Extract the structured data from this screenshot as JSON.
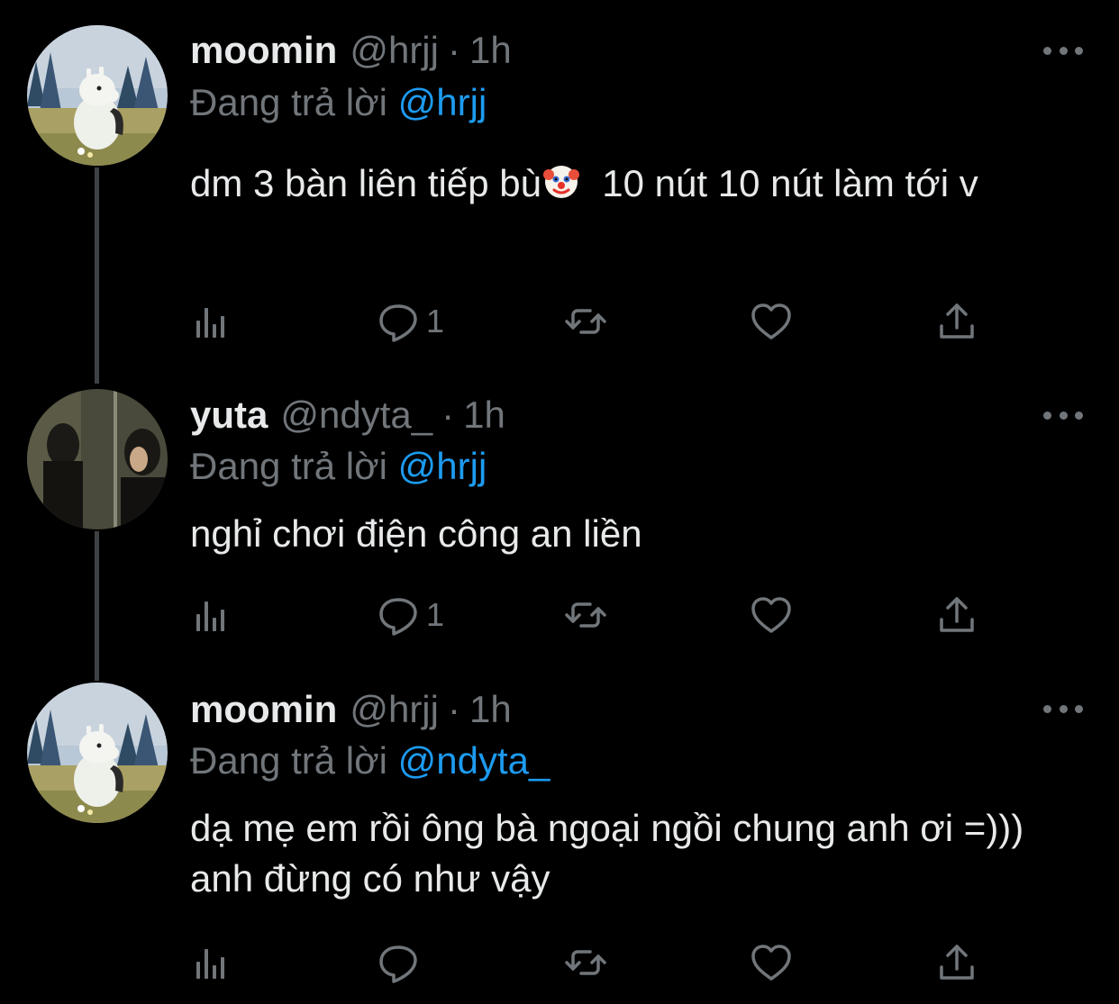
{
  "tweets": [
    {
      "name": "moomin",
      "handle": "@hrjj",
      "separator": "·",
      "time": "1h",
      "replying_prefix": "Đang trả lời",
      "replying_to": "@hrjj",
      "text_before_emoji": "dm 3 bàn liên tiếp bù",
      "emoji": "clown-face",
      "text_after_emoji": "  10 nút 10 nút làm tới v",
      "reply_count": "1",
      "avatar": "moomin-avatar"
    },
    {
      "name": "yuta",
      "handle": "@ndyta_",
      "separator": "·",
      "time": "1h",
      "replying_prefix": "Đang trả lời",
      "replying_to": "@hrjj",
      "text": "nghỉ chơi điện công an liền",
      "reply_count": "1",
      "avatar": "mirror-photo-avatar"
    },
    {
      "name": "moomin",
      "handle": "@hrjj",
      "separator": "·",
      "time": "1h",
      "replying_prefix": "Đang trả lời",
      "replying_to": "@ndyta_",
      "text": "dạ mẹ em rồi ông bà ngoại ngồi chung anh ơi =))) anh đừng có như vậy",
      "reply_count": "",
      "avatar": "moomin-avatar"
    }
  ],
  "colors": {
    "background": "#000000",
    "primary_text": "#e7e9ea",
    "secondary_text": "#71767b",
    "mention": "#1d9bf0",
    "thread_line": "#3e4144"
  },
  "icons": [
    "views-icon",
    "reply-icon",
    "retweet-icon",
    "like-icon",
    "share-icon",
    "more-icon"
  ]
}
